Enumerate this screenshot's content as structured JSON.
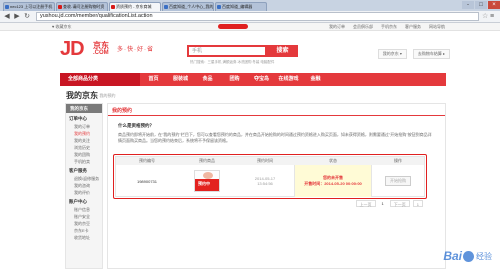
{
  "browser": {
    "tabs": [
      {
        "label": "nec123 上可以注册手机",
        "active": false
      },
      {
        "label": "查收-请问注册购物时资",
        "active": false
      },
      {
        "label": "资质预约 - 京东商城",
        "active": true
      },
      {
        "label": "百度知道_个人中心_我的",
        "active": false
      },
      {
        "label": "百度知道_编辑器",
        "active": false
      }
    ],
    "url": "yushou.jd.com/member/qualificationList.action",
    "window_buttons": [
      "-",
      "□",
      "×"
    ]
  },
  "sitetop": {
    "left": "♥ 收藏京东",
    "right": [
      "我的订单",
      "会员俱乐部",
      "手机京东",
      "客户服务",
      "网站导航"
    ]
  },
  "header": {
    "logo_jd": "JD",
    "logo_cn": "京东",
    "logo_com": ".COM",
    "slogan": "多·快·好·省",
    "search_placeholder": "手机",
    "search_button": "搜索",
    "hot_words": "热门搜索：三星手机  满额返券  冰洗团购  冬装  电脑配件",
    "my_jd": "我的京东 ▾",
    "cart": "去购物车结算 ▸"
  },
  "nav": {
    "all_categories": "全部商品分类",
    "items": [
      "首页",
      "服装城",
      "食品",
      "团购",
      "夺宝岛",
      "在线游戏",
      "金融"
    ]
  },
  "page": {
    "title": "我的京东",
    "breadcrumb": "> 我的预约"
  },
  "sidebar": {
    "head": "我的京东",
    "groups": [
      {
        "title": "订单中心",
        "items": [
          "我的订单",
          "我的预约",
          "我的关注",
          "浏览历史",
          "我的团购",
          "手机拍卖"
        ]
      },
      {
        "title": "客户服务",
        "items": [
          "退换/返修服务",
          "我的咨询",
          "我的评价"
        ]
      },
      {
        "title": "账户中心",
        "items": [
          "账户信息",
          "账户安全",
          "我的京豆",
          "京东E卡",
          "收货地址"
        ]
      }
    ]
  },
  "main": {
    "section_title": "我的预约",
    "question": "什么是资格预约？",
    "answer": "商品预约即将开始前，在\"我的预约\"栏目下，您可以查看您预约的商品，并在商品开始抢购的时间通过预约资格进入购买页面，如未获得资格，则需要通过\"开始抢购\"按钮到商品详情页面购买商品。当您的预约结束后，系统将不予保留该资格。",
    "table": {
      "headers": [
        "预约编号",
        "预约商品",
        "预约时间",
        "状态",
        "操作"
      ],
      "row": {
        "id": "198900731",
        "product_tag": "预约中",
        "time_date": "2014-05-17",
        "time_clock": "13:54:56",
        "status_line1": "您的未开售",
        "status_line2": "开售时间：2014-05-20 00:00:00",
        "operation": "开始抢购"
      }
    },
    "pager": [
      "上一页",
      "1",
      "下一页",
      "1"
    ]
  },
  "watermark": {
    "brand": "Bai",
    "suffix": "经验"
  }
}
